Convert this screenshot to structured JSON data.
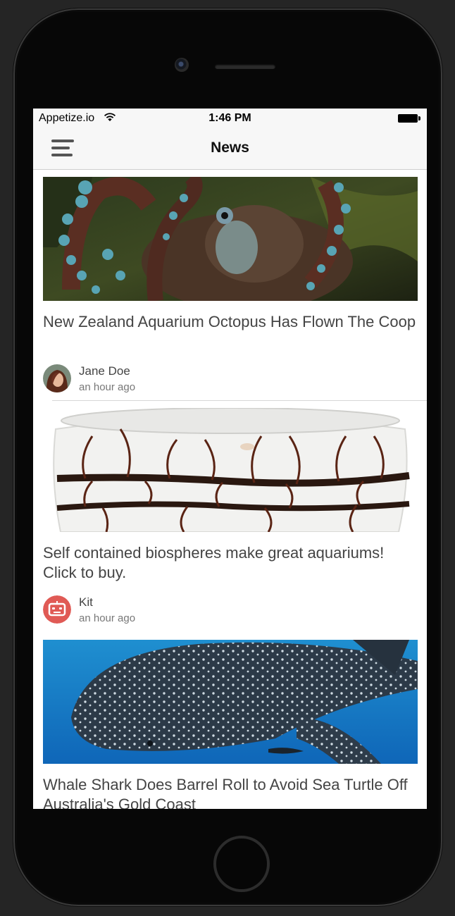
{
  "status_bar": {
    "carrier": "Appetize.io",
    "time": "1:46 PM"
  },
  "nav_bar": {
    "title": "News",
    "menu_icon": "hamburger-menu-icon"
  },
  "feed": {
    "posts": [
      {
        "title": "New Zealand Aquarium Octopus Has Flown The Coop",
        "author": "Jane Doe",
        "time_ago": "an hour ago",
        "image": "octopus-image",
        "avatar": "jane-doe-avatar"
      },
      {
        "title": "Self contained biospheres make great aquariums! Click to buy.",
        "author": "Kit",
        "time_ago": "an hour ago",
        "image": "biosphere-image",
        "avatar": "kit-robot-avatar"
      },
      {
        "title": "Whale Shark Does Barrel Roll to Avoid Sea Turtle Off Australia's Gold Coast",
        "image": "whale-shark-image"
      }
    ]
  }
}
